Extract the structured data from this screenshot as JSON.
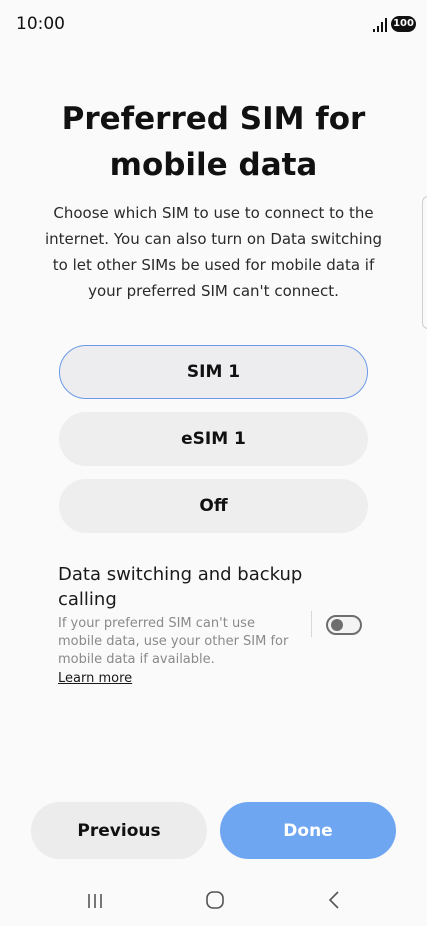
{
  "status_bar": {
    "time": "10:00",
    "battery": "100"
  },
  "page": {
    "title": "Preferred SIM for mobile data",
    "description": "Choose which SIM to use to connect to the internet. You can also turn on Data switching to let other SIMs be used for mobile data if your preferred SIM can't connect."
  },
  "sim_options": [
    {
      "label": "SIM 1",
      "selected": true
    },
    {
      "label": "eSIM 1",
      "selected": false
    },
    {
      "label": "Off",
      "selected": false
    }
  ],
  "data_switching": {
    "title": "Data switching and backup calling",
    "description": "If your preferred SIM can't use mobile data, use your other SIM for mobile data if available.",
    "learn_more": "Learn more",
    "enabled": false
  },
  "buttons": {
    "previous": "Previous",
    "done": "Done"
  },
  "colors": {
    "accent": "#6ea6f2",
    "selected_border": "#6b9ae8"
  },
  "nav_icons": [
    "recents-icon",
    "home-icon",
    "back-icon"
  ]
}
